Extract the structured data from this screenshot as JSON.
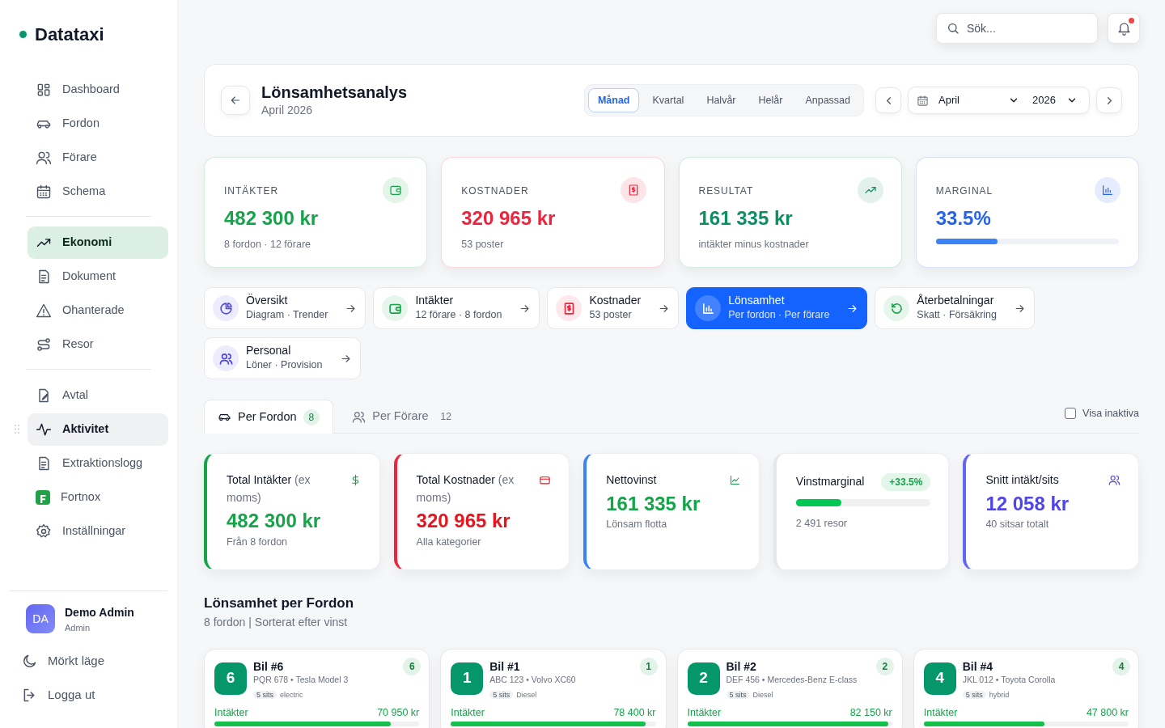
{
  "brand": {
    "name": "Datataxi"
  },
  "sidebar": {
    "groups": [
      {
        "items": [
          {
            "label": "Dashboard",
            "selected": false,
            "hovered": false
          },
          {
            "label": "Fordon",
            "selected": false,
            "hovered": false
          },
          {
            "label": "Förare",
            "selected": false,
            "hovered": false
          },
          {
            "label": "Schema",
            "selected": false,
            "hovered": false
          }
        ]
      },
      {
        "items": [
          {
            "label": "Ekonomi",
            "selected": true,
            "hovered": false
          },
          {
            "label": "Dokument",
            "selected": false,
            "hovered": false
          },
          {
            "label": "Ohanterade",
            "selected": false,
            "hovered": false
          },
          {
            "label": "Resor",
            "selected": false,
            "hovered": false
          }
        ]
      },
      {
        "items": [
          {
            "label": "Avtal",
            "selected": false,
            "hovered": false
          },
          {
            "label": "Aktivitet",
            "selected": false,
            "hovered": true
          },
          {
            "label": "Extraktionslogg",
            "selected": false,
            "hovered": false
          },
          {
            "label": "Fortnox",
            "selected": false,
            "hovered": false
          },
          {
            "label": "Inställningar",
            "selected": false,
            "hovered": false
          }
        ]
      }
    ],
    "user": {
      "initials": "DA",
      "name": "Demo Admin",
      "role": "Admin"
    },
    "actions": [
      "Mörkt läge",
      "Logga ut"
    ]
  },
  "topbar": {
    "search": {
      "placeholder": "Sök..."
    },
    "notifications": {
      "unread": true
    }
  },
  "header": {
    "title": "Lönsamhetsanalys",
    "subtitle": "April 2026",
    "periods": [
      {
        "label": "Månad",
        "selected": true
      },
      {
        "label": "Kvartal",
        "selected": false
      },
      {
        "label": "Halvår",
        "selected": false
      },
      {
        "label": "Helår",
        "selected": false
      },
      {
        "label": "Anpassad",
        "selected": false
      }
    ],
    "month": "April",
    "year": "2026"
  },
  "kpis": [
    {
      "label": "INTÄKTER",
      "value": "482 300 kr",
      "sub": "8 fordon · 12 förare",
      "color": "#16a34a"
    },
    {
      "label": "KOSTNADER",
      "value": "320 965 kr",
      "sub": "53 poster",
      "color": "#ef233c"
    },
    {
      "label": "RESULTAT",
      "value": "161 335 kr",
      "sub": "intäkter minus kostnader",
      "color": "#0d8f63"
    },
    {
      "label": "MARGINAL",
      "value": "33.5%",
      "color": "#2563eb",
      "level": 0.335
    }
  ],
  "nav_cards": [
    {
      "title": "Översikt",
      "subtitle": "Diagram · Trender",
      "color": "#4f46e5",
      "selected": false
    },
    {
      "title": "Intäkter",
      "subtitle": "12 förare · 8 fordon",
      "color": "#16a34a",
      "selected": false
    },
    {
      "title": "Kostnader",
      "subtitle": "53 poster",
      "color": "#ef233c",
      "selected": false
    },
    {
      "title": "Lönsamhet",
      "subtitle": "Per fordon · Per förare",
      "color": "#1463ff",
      "selected": true
    },
    {
      "title": "Återbetalningar",
      "subtitle": "Skatt · Försäkring",
      "color": "#16a34a",
      "selected": false
    },
    {
      "title": "Personal",
      "subtitle": "Löner · Provision",
      "color": "#4f46e5",
      "selected": false
    }
  ],
  "view_tabs": [
    {
      "label": "Per Fordon",
      "count": "8",
      "selected": true
    },
    {
      "label": "Per Förare",
      "count": "12",
      "selected": false
    }
  ],
  "show_inactive": {
    "label": "Visa inaktiva",
    "checked": false
  },
  "stats": [
    {
      "title": "Total Intäkter",
      "note": "(ex moms)",
      "value": "482 300 kr",
      "sub": "Från 8 fordon",
      "color": "#16a34a",
      "accent": {
        "color": "#16a34a"
      }
    },
    {
      "title": "Total Kostnader",
      "note": "(ex moms)",
      "value": "320 965 kr",
      "sub": "Alla kategorier",
      "color": "#e5161e",
      "accent": {
        "color": "#ef233c"
      }
    },
    {
      "title": "Nettovinst",
      "value": "161 335 kr",
      "sub": "Lönsam flotta",
      "color": "#16a34a",
      "accent": {
        "color": "#3b82f6"
      }
    },
    {
      "title": "Vinstmarginal",
      "badge": "+33.5%",
      "level": 0.335,
      "sub": "2 491 resor",
      "color": "#00c853"
    },
    {
      "title": "Snitt intäkt/sits",
      "value": "12 058 kr",
      "sub": "40 sitsar totalt",
      "color": "#4f46e5",
      "accent": {
        "color": "#6366f1"
      }
    }
  ],
  "section": {
    "title": "Lönsamhet per Fordon",
    "subtitle": "8 fordon | Sorterat efter vinst"
  },
  "vehicles": [
    {
      "rank": "6",
      "name": "Bil #6",
      "details": "PQR 678 • Tesla Model 3",
      "seats": "5 sits",
      "fuel": "electric",
      "badge": "6",
      "revenue_label": "Intäkter",
      "revenue": "70 950 kr",
      "level": 0.86
    },
    {
      "rank": "1",
      "name": "Bil #1",
      "details": "ABC 123 • Volvo XC60",
      "seats": "5 sits",
      "fuel": "Diesel",
      "badge": "1",
      "revenue_label": "Intäkter",
      "revenue": "78 400 kr",
      "level": 0.95
    },
    {
      "rank": "2",
      "name": "Bil #2",
      "details": "DEF 456 • Mercedes-Benz E-class",
      "seats": "5 sits",
      "fuel": "Diesel",
      "badge": "2",
      "revenue_label": "Intäkter",
      "revenue": "82 150 kr",
      "level": 0.98
    },
    {
      "rank": "4",
      "name": "Bil #4",
      "details": "JKL 012 • Toyota Corolla",
      "seats": "5 sits",
      "fuel": "hybrid",
      "badge": "4",
      "revenue_label": "Intäkter",
      "revenue": "47 800 kr",
      "level": 0.59
    }
  ]
}
